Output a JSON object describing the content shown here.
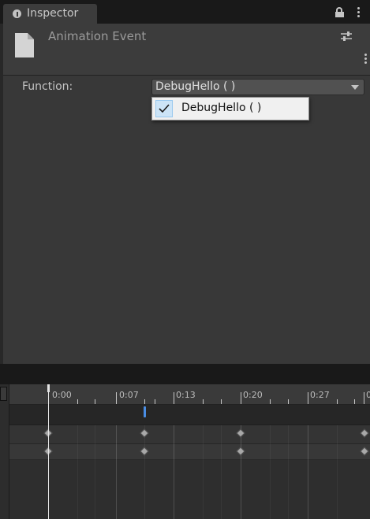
{
  "inspector": {
    "tab_label": "Inspector",
    "header_title": "Animation Event",
    "function_label": "Function:",
    "function_value": "DebugHello ( )",
    "dropdown_option": "DebugHello ( )",
    "option_selected": true
  },
  "timeline": {
    "time_labels": [
      "0:00",
      "0:07",
      "0:13",
      "0:20",
      "0:27",
      "0"
    ],
    "colors": {
      "event_marker": "#4a8ee5",
      "playhead": "#e6e6e6",
      "keyframe": "#a8a8a8"
    }
  }
}
